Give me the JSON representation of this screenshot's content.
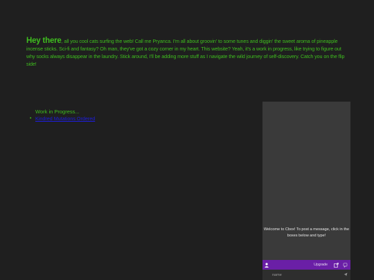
{
  "intro": {
    "greeting": "Hey there",
    "body": ", all you cool cats surfing the web! Call me Pryanca. I'm all about groovin' to some tunes and diggin' the sweet aroma of pineapple incense sticks. Sci-fi and fantasy? Oh man, they've got a cozy corner in my heart. This website? Yeah, it's a work in progress, like trying to figure out why socks always disappear in the laundry. Stick around, I'll be adding more stuff as I navigate the wild journey of self-discovery. Catch you on the flip side!"
  },
  "wip": {
    "heading": "Work in Progress...",
    "links": [
      {
        "bullet": "•",
        "label": "Kindred Mutations Ordered"
      }
    ]
  },
  "cbox": {
    "welcome": "Welcome to Cbox! To post a message, click in the boxes below and type!",
    "upgrade_label": "Upgrade",
    "name_placeholder": "name",
    "user_icon": "user-icon",
    "external_icon": "external-link-icon",
    "chat_icon": "chat-icon",
    "send_icon": "send-icon",
    "bar_color": "#6a1fa6"
  },
  "colors": {
    "background": "#1f1f1f",
    "text": "#3fbf1f",
    "link": "#1d1de0"
  }
}
